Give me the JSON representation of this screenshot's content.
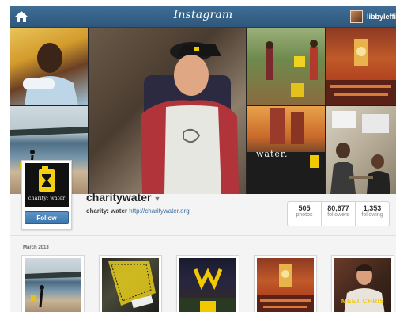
{
  "header": {
    "logo": "Instagram",
    "username": "libbyleffi",
    "home_icon": "home-icon"
  },
  "profile": {
    "name": "charitywater",
    "bio_name": "charity: water",
    "bio_link": "http://charitywater.org",
    "avatar_text": "charity: water",
    "follow_label": "Follow"
  },
  "stats": [
    {
      "num": "505",
      "label": "photos"
    },
    {
      "num": "80,677",
      "label": "followers"
    },
    {
      "num": "1,353",
      "label": "following"
    }
  ],
  "feed": {
    "month": "March 2013",
    "meet_caption": "MEET CHRIS",
    "tag_text": "water."
  },
  "colors": {
    "brand_blue": "#2e577c",
    "charity_yellow": "#f5d00f",
    "link": "#3b6e9e"
  }
}
